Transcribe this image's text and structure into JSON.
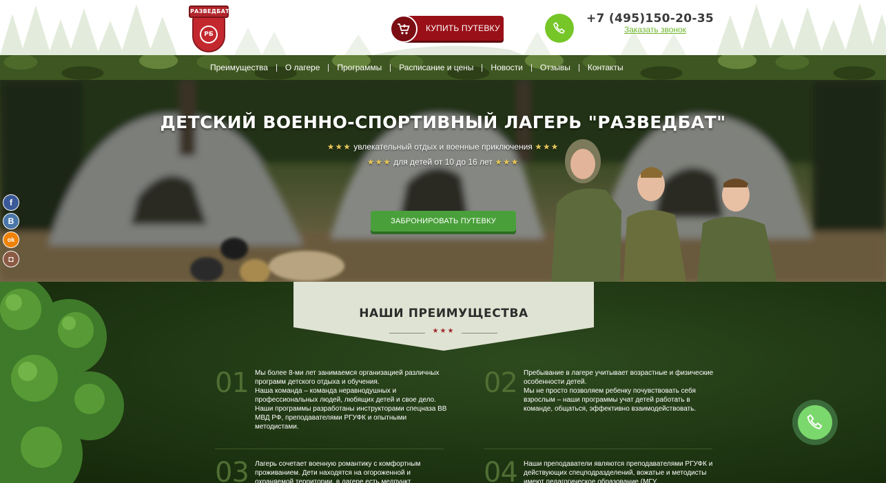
{
  "header": {
    "logo_text": "РАЗВЕДБАТ",
    "logo_emblem": "РБ",
    "buy_button": "КУПИТЬ ПУТЕВКУ",
    "cart_icon": "cart-icon",
    "call_icon": "phone-icon",
    "phone": "+7 (495)150-20-35",
    "callback_link": "Заказать звонок"
  },
  "nav": {
    "items": [
      "Преимущества",
      "О лагере",
      "Программы",
      "Расписание и цены",
      "Новости",
      "Отзывы",
      "Контакты"
    ]
  },
  "hero": {
    "title": "ДЕТСКИЙ ВОЕННО-СПОРТИВНЫЙ ЛАГЕРЬ \"РАЗВЕДБАТ\"",
    "subtitle1": "увлекательный отдых и военные приключения",
    "subtitle2": "для детей от 10 до 16 лет",
    "stars": "★★★",
    "book_button": "ЗАБРОНИРОВАТЬ ПУТЕВКУ"
  },
  "social": [
    {
      "icon": "facebook-icon",
      "glyph": "f",
      "color": "#3b5998"
    },
    {
      "icon": "vk-icon",
      "glyph": "B",
      "color": "#4a76a8"
    },
    {
      "icon": "odnoklassniki-icon",
      "glyph": "ok",
      "color": "#ee8208"
    },
    {
      "icon": "instagram-icon",
      "glyph": "◘",
      "color": "#8a5a44"
    }
  ],
  "advantages": {
    "title": "НАШИ ПРЕИМУЩЕСТВА",
    "stars": "★★★",
    "items": [
      {
        "num": "01",
        "text": [
          "Мы более 8-ми лет занимаемся организацией различных программ детского отдыха и обучения.",
          "Наша команда – команда неравнодушных и профессиональных людей, любящих детей и свое дело.",
          "Наши программы разработаны инструкторами спецназа ВВ МВД РФ, преподавателями РГУФК и опытными методистами."
        ]
      },
      {
        "num": "02",
        "text": [
          "Пребывание в лагере учитывает возрастные и физические особенности детей.",
          "Мы не просто позволяем ребенку почувствовать себя взрослым – наши программы учат детей работать в команде, общаться, эффективно взаимодействовать."
        ]
      },
      {
        "num": "03",
        "text": [
          "Лагерь сочетает военную романтику с комфортным проживанием. Дети находятся на огороженной и охраняемой территории, в лагере есть медпункт"
        ]
      },
      {
        "num": "04",
        "text": [
          "Наши преподаватели являются преподавателями РГУФК и действующих спецподразделений, вожатые и методисты имеют педагогическое образование (МГУ,"
        ]
      }
    ]
  },
  "floating_call_icon": "phone-icon",
  "colors": {
    "accent_red": "#9a1018",
    "accent_green": "#49a03a",
    "call_green": "#76c628",
    "nav_camo": "#3e5621"
  }
}
